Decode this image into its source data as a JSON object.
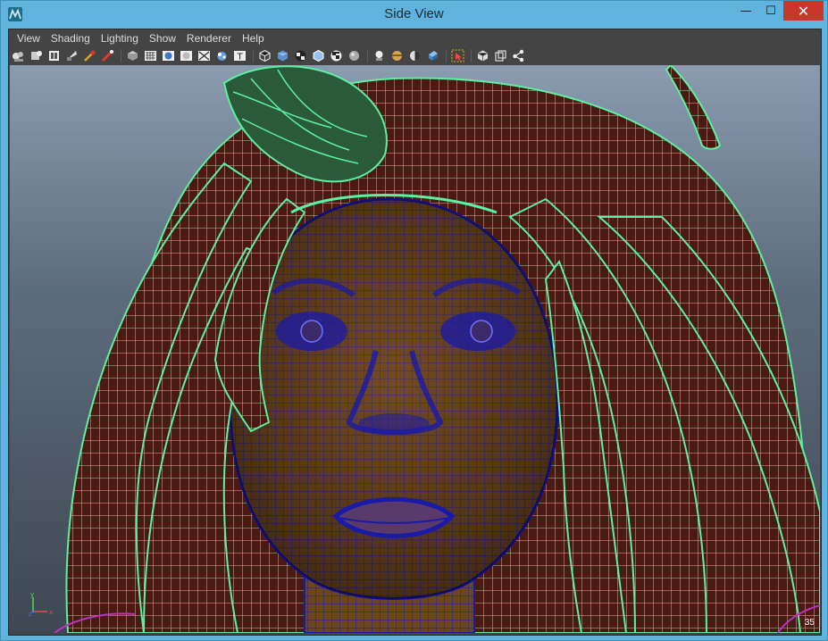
{
  "window": {
    "title": "Side View",
    "controls": {
      "minimize": "—",
      "maximize": "☐",
      "close": "✕"
    }
  },
  "menubar": {
    "items": [
      "View",
      "Shading",
      "Lighting",
      "Show",
      "Renderer",
      "Help"
    ]
  },
  "toolbar": {
    "groups": [
      [
        "camera-attributes-icon",
        "bookmark-icon",
        "image-plane-icon",
        "2d-pan-icon",
        "grease-pencil-icon",
        "isolate-icon"
      ],
      [
        "wireframe-icon",
        "smooth-shade-icon",
        "textured-icon",
        "use-lights-icon",
        "shadows-icon",
        "xray-icon",
        "xray-joints-icon"
      ],
      [
        "wireframe-on-shaded-icon",
        "cube-smooth-icon",
        "cube-texture-icon",
        "cube-xray-icon",
        "checker-icon",
        "sphere-grey-icon",
        "light-bulb-icon"
      ],
      [
        "sphere-white-icon",
        "material-icon",
        "backface-icon",
        "cube-blue-icon"
      ],
      [
        "select-camera-icon"
      ],
      [
        "camera-frame-icon",
        "film-gate-icon",
        "graph-icon"
      ]
    ]
  },
  "viewport": {
    "axis_y": "y",
    "axis_x": "x",
    "axis_z": "z",
    "frame_count": "35"
  },
  "colors": {
    "accent_title": "#5fb3dc",
    "close_button": "#c7382b",
    "hair_wire": "#5cf0a0",
    "hair_fill": "#4a1a12",
    "face_wire": "#1a1aa8",
    "face_fill": "#6b4420"
  }
}
